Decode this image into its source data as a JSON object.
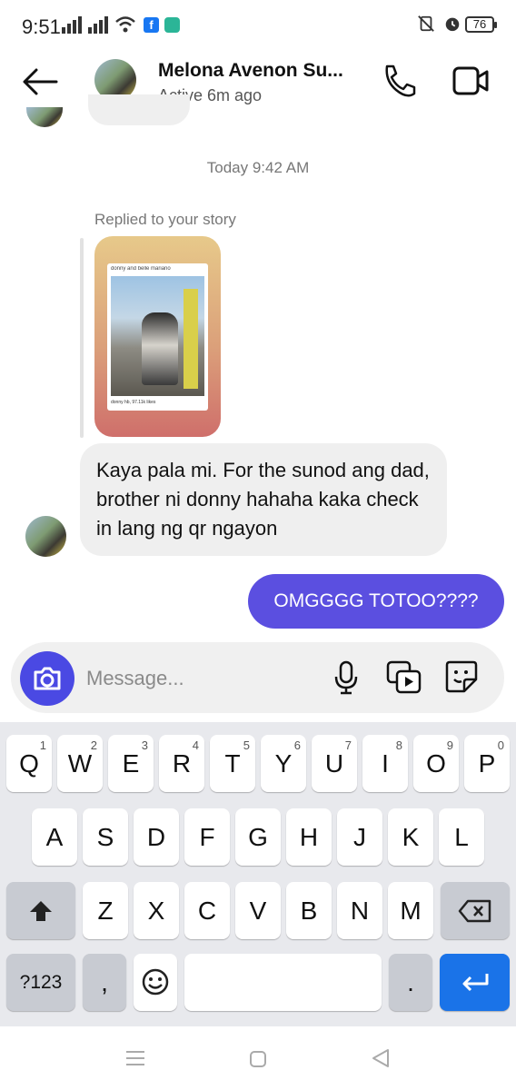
{
  "status_bar": {
    "time": "9:51",
    "battery": "76"
  },
  "header": {
    "contact_name": "Melona Avenon Su...",
    "presence": "Active 6m ago"
  },
  "chat": {
    "timestamp": "Today 9:42 AM",
    "reply_label": "Replied to your story",
    "story_caption": "donny and belle mariano",
    "story_footer": "donny hb, 97.11k likes",
    "incoming_message": "Kaya pala mi. For the sunod ang dad, brother ni donny hahaha kaka check in lang ng qr ngayon",
    "outgoing_message": "OMGGGG TOTOO????"
  },
  "composer": {
    "placeholder": "Message..."
  },
  "keyboard": {
    "row1": [
      {
        "k": "Q",
        "n": "1"
      },
      {
        "k": "W",
        "n": "2"
      },
      {
        "k": "E",
        "n": "3"
      },
      {
        "k": "R",
        "n": "4"
      },
      {
        "k": "T",
        "n": "5"
      },
      {
        "k": "Y",
        "n": "6"
      },
      {
        "k": "U",
        "n": "7"
      },
      {
        "k": "I",
        "n": "8"
      },
      {
        "k": "O",
        "n": "9"
      },
      {
        "k": "P",
        "n": "0"
      }
    ],
    "row2": [
      "A",
      "S",
      "D",
      "F",
      "G",
      "H",
      "J",
      "K",
      "L"
    ],
    "row3": [
      "Z",
      "X",
      "C",
      "V",
      "B",
      "N",
      "M"
    ],
    "mode_key": "?123",
    "comma": ",",
    "period": "."
  },
  "colors": {
    "accent": "#5b4fe0",
    "camera": "#4a49e3",
    "enter_key": "#1a73e8"
  }
}
